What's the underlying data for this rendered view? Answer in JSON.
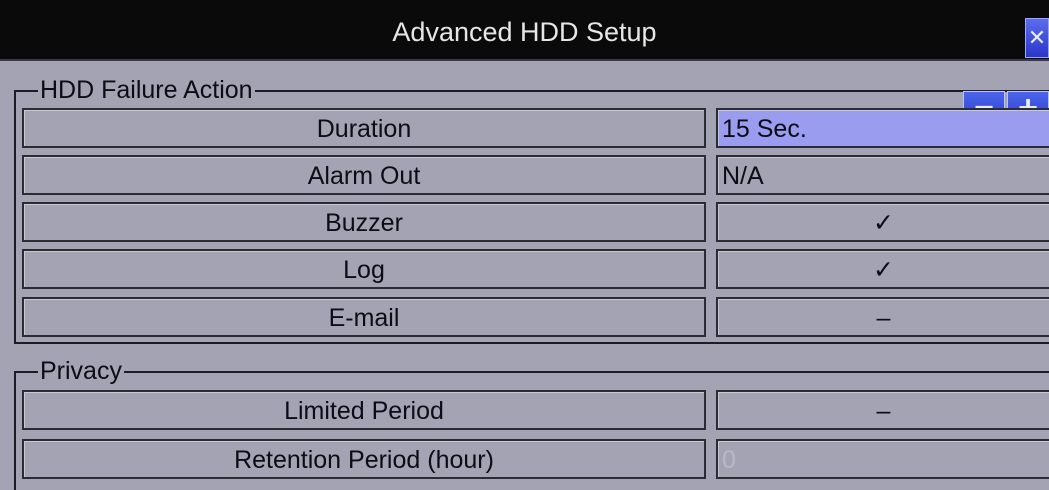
{
  "window": {
    "title": "Advanced HDD Setup",
    "close_icon": "close-icon"
  },
  "hdd_failure": {
    "legend": "HDD Failure Action",
    "stepper": {
      "minus": "−",
      "plus": "+"
    },
    "rows": [
      {
        "label": "Duration",
        "value": "15 Sec."
      },
      {
        "label": "Alarm Out",
        "value": "N/A"
      },
      {
        "label": "Buzzer",
        "value": "✓"
      },
      {
        "label": "Log",
        "value": "✓"
      },
      {
        "label": "E-mail",
        "value": "–"
      }
    ]
  },
  "privacy": {
    "legend": "Privacy",
    "rows": [
      {
        "label": "Limited Period",
        "value": "–"
      },
      {
        "label": "Retention Period (hour)",
        "value": "0"
      }
    ]
  },
  "colors": {
    "background": "#a3a3b4",
    "title_bar": "#0a0a0a",
    "selected_field": "#9a9cf0",
    "button": "#3a4fe0"
  }
}
